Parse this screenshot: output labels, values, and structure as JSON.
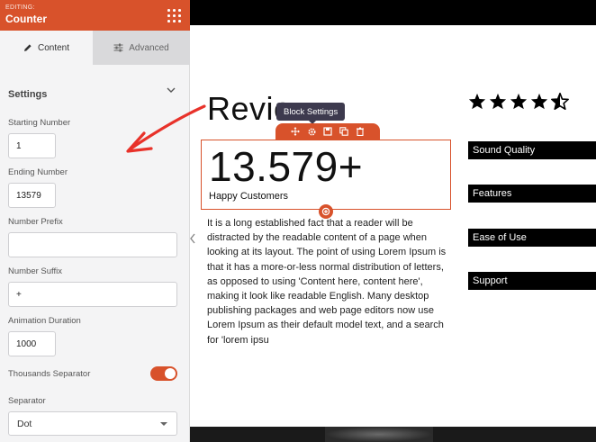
{
  "panel": {
    "editing_label": "EDITING:",
    "title": "Counter",
    "tabs": [
      {
        "label": "Content",
        "active": true
      },
      {
        "label": "Advanced",
        "active": false
      }
    ],
    "section_title": "Settings",
    "fields": {
      "starting_number": {
        "label": "Starting Number",
        "value": "1"
      },
      "ending_number": {
        "label": "Ending Number",
        "value": "13579"
      },
      "number_prefix": {
        "label": "Number Prefix",
        "value": ""
      },
      "number_suffix": {
        "label": "Number Suffix",
        "value": "+"
      },
      "animation_duration": {
        "label": "Animation Duration",
        "value": "1000"
      },
      "thousands_separator": {
        "label": "Thousands Separator",
        "enabled": true
      },
      "separator": {
        "label": "Separator",
        "selected": "Dot"
      }
    }
  },
  "canvas": {
    "heading": "Revie",
    "tooltip": "Block Settings",
    "block_toolbar_icons": [
      "move-icon",
      "gear-icon",
      "save-icon",
      "duplicate-icon",
      "trash-icon"
    ],
    "counter": {
      "number": "13.579+",
      "label": "Happy Customers"
    },
    "body_text": "It is a long established fact that a reader will be distracted by the readable content of a page when looking at its layout. The point of using Lorem Ipsum is that it has a more-or-less normal distribution of letters, as opposed to using 'Content here, content here', making it look like readable English. Many desktop publishing packages and web page editors now use Lorem Ipsum as their default model text, and a search for 'lorem ipsu",
    "rating": 4.5,
    "feature_bars": [
      "Sound Quality",
      "Features",
      "Ease of Use",
      "Support"
    ]
  },
  "colors": {
    "accent": "#d8522b",
    "panel_bg": "#f4f4f5",
    "annotation": "#e8322a",
    "tooltip_bg": "#3d3a4e"
  }
}
